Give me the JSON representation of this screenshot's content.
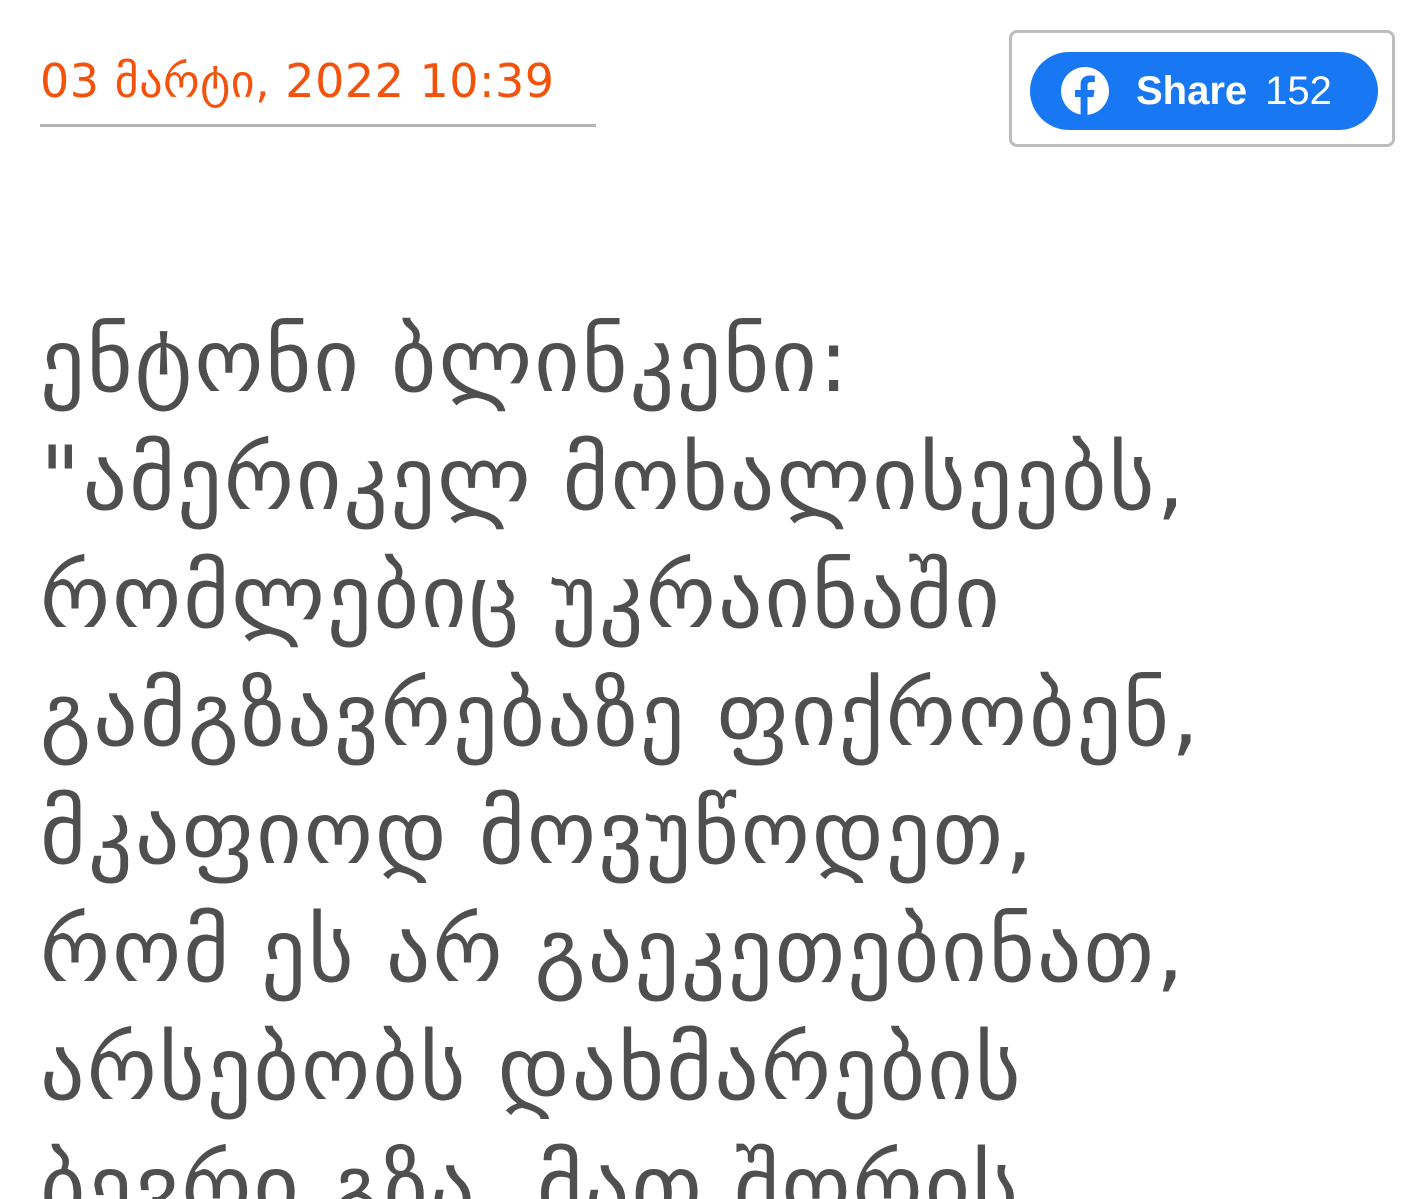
{
  "article": {
    "date": "03 მარტი, 2022 10:39",
    "title_lines": [
      "ენტონი ბლინკენი:",
      "\"ამერიკელ მოხალისეებს,",
      "რომლებიც უკრაინაში",
      "გამგზავრებაზე ფიქრობენ,",
      "მკაფიოდ მოვუწოდეთ,",
      "რომ ეს არ გაეკეთებინათ,",
      "არსებობს დახმარების",
      "ბევრი გზა, მათ შორის"
    ]
  },
  "share": {
    "icon": "facebook-icon",
    "label": "Share",
    "count": "152",
    "color": "#1877f2"
  },
  "colors": {
    "date": "#f2520b",
    "title": "#4f4f4f"
  }
}
